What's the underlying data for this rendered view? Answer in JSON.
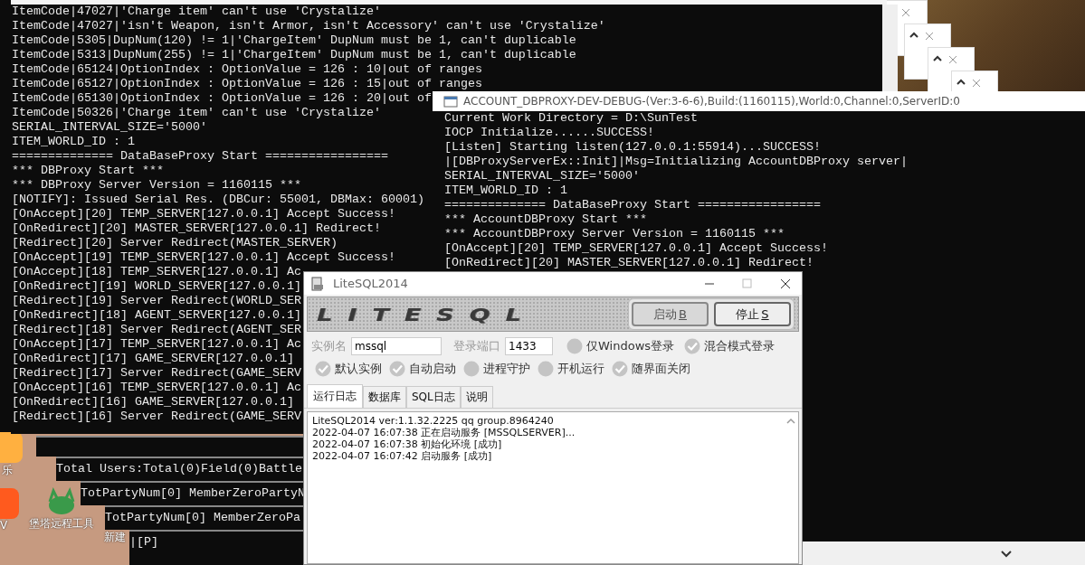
{
  "desktop": {
    "icons": [
      {
        "label": "乐",
        "kind": "app"
      },
      {
        "label": "V",
        "kind": "video"
      },
      {
        "label": "堡塔远程工具",
        "kind": "remote"
      },
      {
        "label": "新建",
        "kind": "file"
      }
    ]
  },
  "main_console": {
    "lines": [
      "ItemCode|47027|'Charge item' can't use 'Crystalize'",
      "ItemCode|47027|'isn't Weapon, isn't Armor, isn't Accessory' can't use 'Crystalize'",
      "ItemCode|5305|DupNum(120) != 1|'ChargeItem' DupNum must be 1, can't duplicable",
      "ItemCode|5313|DupNum(255) != 1|'ChargeItem' DupNum must be 1, can't duplicable",
      "ItemCode|65124|OptionIndex : OptionValue = 126 : 10|out of ranges",
      "ItemCode|65127|OptionIndex : OptionValue = 126 : 15|out of ranges",
      "ItemCode|65130|OptionIndex : OptionValue = 126 : 20|out of",
      "ItemCode|50326|'Charge item' can't use 'Crystalize'",
      "SERIAL_INTERVAL_SIZE='5000'",
      "ITEM_WORLD_ID : 1",
      "============== DataBaseProxy Start =================",
      "*** DBProxy Start ***",
      "*** DBProxy Server Version = 1160115 ***",
      "[NOTIFY]: Issued Serial Res. (DBCur: 55001, DBMax: 60001)",
      "[OnAccept][20] TEMP_SERVER[127.0.0.1] Accept Success!",
      "[OnRedirect][20] MASTER_SERVER[127.0.0.1] Redirect!",
      "[Redirect][20] Server Redirect(MASTER_SERVER)",
      "[OnAccept][19] TEMP_SERVER[127.0.0.1] Accept Success!",
      "[OnAccept][18] TEMP_SERVER[127.0.0.1] Ac",
      "[OnRedirect][19] WORLD_SERVER[127.0.0.1]",
      "[Redirect][19] Server Redirect(WORLD_SER",
      "[OnRedirect][18] AGENT_SERVER[127.0.0.1]",
      "[Redirect][18] Server Redirect(AGENT_SER",
      "[OnAccept][17] TEMP_SERVER[127.0.0.1] Ac",
      "[OnRedirect][17] GAME_SERVER[127.0.0.1]",
      "[Redirect][17] Server Redirect(GAME_SERV",
      "[OnAccept][16] TEMP_SERVER[127.0.0.1] Ac",
      "[OnRedirect][16] GAME_SERVER[127.0.0.1]",
      "[Redirect][16] Server Redirect(GAME_SERV"
    ]
  },
  "background_consoles": [
    {
      "line": "Total Users:Total(0)Field(0)Battle"
    },
    {
      "line": "TotPartyNum[0] MemberZeroPartyN"
    },
    {
      "line": "TotPartyNum[0] MemberZeroPa"
    },
    {
      "line": "|[P]"
    }
  ],
  "account_window": {
    "title": "ACCOUNT_DBPROXY-DEV-DEBUG-(Ver:3-6-6),Build:(1160115),World:0,Channel:0,ServerID:0",
    "lines": [
      "Current Work Directory = D:\\SunTest",
      "IOCP Initialize......SUCCESS!",
      "[Listen] Starting listen(127.0.0.1:55914)...SUCCESS!",
      "|[DBProxyServerEx::Init]|Msg=Initializing AccountDBProxy server|",
      "SERIAL_INTERVAL_SIZE='5000'",
      "ITEM_WORLD_ID : 1",
      "============== DataBaseProxy Start =================",
      "*** AccountDBProxy Start ***",
      "*** AccountDBProxy Server Version = 1160115 ***",
      "[OnAccept][20] TEMP_SERVER[127.0.0.1] Accept Success!",
      "[OnRedirect][20] MASTER_SERVER[127.0.0.1] Redirect!"
    ]
  },
  "litesql": {
    "title": "LiteSQL2014",
    "logo": "LITESQL",
    "buttons": [
      {
        "label": "启动",
        "key": "B",
        "disabled": true
      },
      {
        "label": "停止",
        "key": "S",
        "disabled": false
      }
    ],
    "fields": [
      {
        "label": "实例名",
        "value": "mssql",
        "kind": "wide"
      },
      {
        "label": "登录端口",
        "value": "1433",
        "kind": "narrow"
      }
    ],
    "radios": [
      {
        "label": "仅Windows登录",
        "selected": false
      },
      {
        "label": "混合模式登录",
        "selected": true
      }
    ],
    "checks": [
      {
        "label": "默认实例",
        "checked": true
      },
      {
        "label": "自动启动",
        "checked": true
      },
      {
        "label": "进程守护",
        "checked": false
      },
      {
        "label": "开机运行",
        "checked": false
      },
      {
        "label": "随界面关闭",
        "checked": true
      }
    ],
    "tabs": [
      {
        "label": "运行日志",
        "selected": true
      },
      {
        "label": "数据库",
        "selected": false
      },
      {
        "label": "SQL日志",
        "selected": false
      },
      {
        "label": "说明",
        "selected": false
      }
    ],
    "log": [
      "LiteSQL2014 ver:1.1.32.2225 qq group.8964240",
      "2022-04-07 16:07:38 正在启动服务 [MSSQLSERVER]...",
      "2022-04-07 16:07:38 初始化环境 [成功]",
      "2022-04-07 16:07:42 启动服务 [成功]"
    ]
  }
}
